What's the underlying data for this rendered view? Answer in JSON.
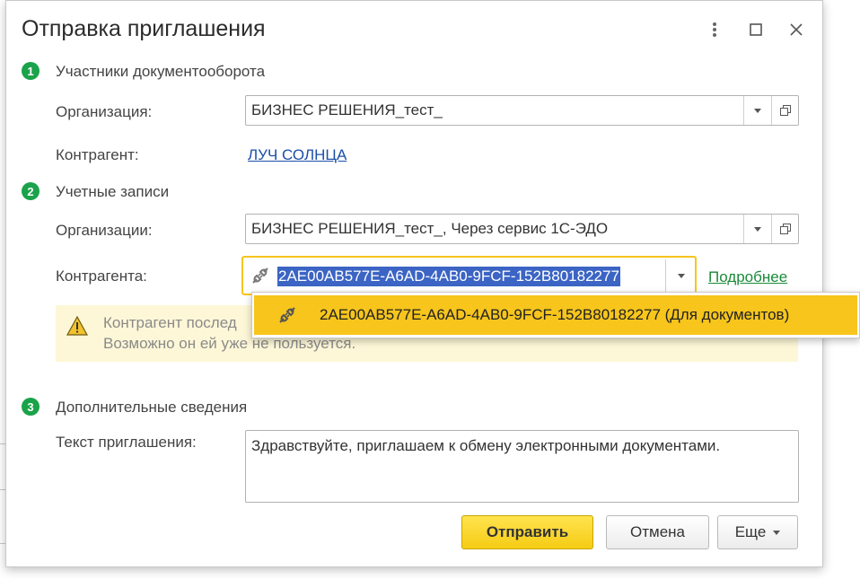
{
  "dialog": {
    "title": "Отправка приглашения"
  },
  "section1": {
    "number": "1",
    "title": "Участники документооборота",
    "organization_label": "Организация:",
    "organization_value": "БИЗНЕС РЕШЕНИЯ_тест_",
    "counterparty_label": "Контрагент:",
    "counterparty_link": "ЛУЧ СОЛНЦА"
  },
  "section2": {
    "number": "2",
    "title": "Учетные записи",
    "organizations_label": "Организации:",
    "organizations_value": "БИЗНЕС РЕШЕНИЯ_тест_, Через сервис 1С-ЭДО",
    "counterparty_label": "Контрагента:",
    "counterparty_value": "2AE00AB577E-A6AD-4AB0-9FCF-152B80182277",
    "details_link": "Подробнее",
    "warning_line1": "Контрагент послед",
    "warning_line2": "Возможно он ей уже не пользуется."
  },
  "dropdown": {
    "option": "2AE00AB577E-A6AD-4AB0-9FCF-152B80182277 (Для документов)"
  },
  "section3": {
    "number": "3",
    "title": "Дополнительные сведения",
    "text_label": "Текст приглашения:",
    "text_value": "Здравствуйте, приглашаем к обмену электронными документами."
  },
  "buttons": {
    "send": "Отправить",
    "cancel": "Отмена",
    "more": "Еще"
  },
  "colors": {
    "accent_green": "#1aa34a",
    "link_blue": "#1a4fa8",
    "link_green": "#1b8a3a",
    "highlight_yellow": "#f7c51c",
    "warning_bg": "#fdf7d7"
  }
}
